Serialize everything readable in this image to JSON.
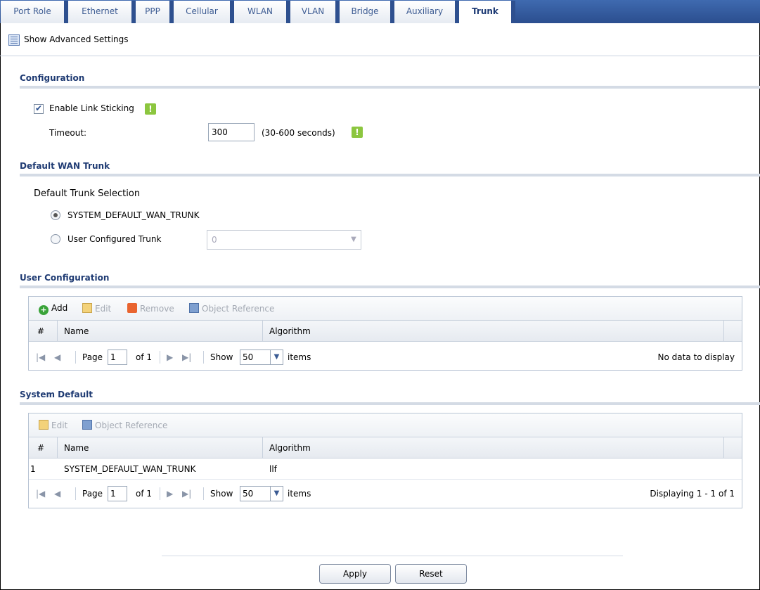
{
  "tabs": [
    "Port Role",
    "Ethernet",
    "PPP",
    "Cellular",
    "WLAN",
    "VLAN",
    "Bridge",
    "Auxiliary",
    "Trunk"
  ],
  "active_tab": "Trunk",
  "advanced_label": "Show Advanced Settings",
  "configuration": {
    "title": "Configuration",
    "enable_link_sticking": "Enable Link Sticking",
    "timeout_label": "Timeout:",
    "timeout_value": "300",
    "timeout_hint": "(30-600 seconds)"
  },
  "default_wan_trunk": {
    "title": "Default WAN Trunk",
    "selection_label": "Default Trunk Selection",
    "option_system": "SYSTEM_DEFAULT_WAN_TRUNK",
    "option_user": "User Configured Trunk",
    "user_select_value": "0"
  },
  "user_configuration": {
    "title": "User Configuration",
    "toolbar": {
      "add": "Add",
      "edit": "Edit",
      "remove": "Remove",
      "object_reference": "Object Reference"
    },
    "columns": [
      "#",
      "Name",
      "Algorithm"
    ],
    "pager": {
      "page_label": "Page",
      "page": "1",
      "of": "of 1",
      "show": "Show",
      "per_page": "50",
      "items": "items",
      "status": "No data to display"
    }
  },
  "system_default": {
    "title": "System Default",
    "toolbar": {
      "edit": "Edit",
      "object_reference": "Object Reference"
    },
    "columns": [
      "#",
      "Name",
      "Algorithm"
    ],
    "rows": [
      {
        "num": "1",
        "name": "SYSTEM_DEFAULT_WAN_TRUNK",
        "algorithm": "llf"
      }
    ],
    "pager": {
      "page_label": "Page",
      "page": "1",
      "of": "of 1",
      "show": "Show",
      "per_page": "50",
      "items": "items",
      "status": "Displaying 1 - 1 of 1"
    }
  },
  "buttons": {
    "apply": "Apply",
    "reset": "Reset"
  }
}
